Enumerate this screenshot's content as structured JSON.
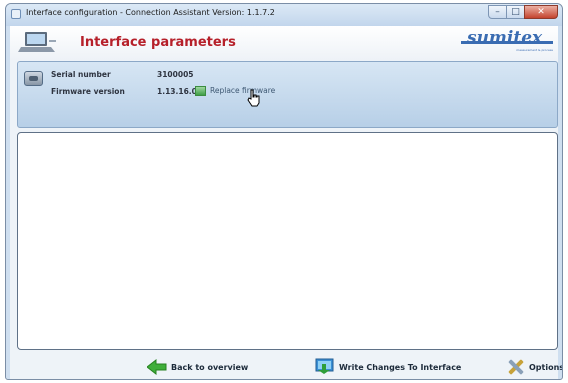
{
  "window": {
    "title": "Interface configuration - Connection Assistant Version: 1.1.7.2",
    "minimize_glyph": "–",
    "maximize_glyph": "□",
    "close_glyph": "✕"
  },
  "header": {
    "title": "Interface parameters",
    "icon": "laptop-icon",
    "logo_text": "sumitex",
    "logo_tagline": "measurement & process",
    "brand_color": "#b6202a",
    "logo_color": "#3a6cb2"
  },
  "device_info": {
    "icon": "chip-icon",
    "serial_label": "Serial number",
    "serial_value": "3100005",
    "firmware_label": "Firmware version",
    "firmware_value": "1.13.16.0",
    "replace_icon": "firmware-update-icon",
    "replace_label": "Replace firmware"
  },
  "footer": {
    "back_icon": "arrow-left-icon",
    "back_label": "Back to overview",
    "write_icon": "write-to-interface-icon",
    "write_label": "Write Changes To Interface",
    "options_icon": "tools-icon",
    "options_label": "Options"
  }
}
